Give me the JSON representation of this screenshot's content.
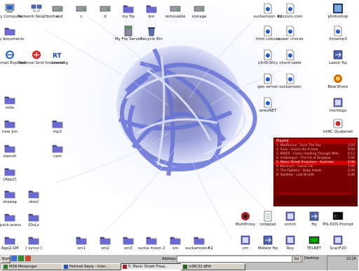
{
  "desktop": {
    "icons_left": [
      {
        "label": "My Computer",
        "icon": "my-computer-icon"
      },
      {
        "label": "Network Neighborhood",
        "icon": "network-icon"
      },
      {
        "label": "e",
        "icon": "drive-icon"
      },
      {
        "label": "c",
        "icon": "drive-icon"
      },
      {
        "label": "d",
        "icon": "drive-icon"
      },
      {
        "label": "my ftp",
        "icon": "folder-icon"
      },
      {
        "label": "bin",
        "icon": "folder-icon"
      },
      {
        "label": "removable",
        "icon": "drive-icon"
      },
      {
        "label": "storage",
        "icon": "drive-icon"
      },
      {
        "label": "my documents",
        "icon": "folder-icon"
      },
      {
        "label": "My Ftp Server",
        "icon": "server-icon"
      },
      {
        "label": "Recycle Bin",
        "icon": "recycle-bin-icon"
      },
      {
        "label": "Internet Explorer",
        "icon": "internet-explorer-icon"
      },
      {
        "label": "National Grid for Learning",
        "icon": "ngfl-icon"
      },
      {
        "label": "connect",
        "icon": "connect-icon"
      },
      {
        "label": "m0e",
        "icon": "folder-icon"
      },
      {
        "label": "new $m",
        "icon": "folder-icon"
      },
      {
        "label": "mp3",
        "icon": "folder-icon"
      },
      {
        "label": "stenoh",
        "icon": "folder-icon"
      },
      {
        "label": "cam",
        "icon": "folder-icon"
      },
      {
        "label": "[App2]",
        "icon": "folder-icon"
      },
      {
        "label": "sheeep",
        "icon": "folder-icon"
      },
      {
        "label": "skool",
        "icon": "folder-icon"
      },
      {
        "label": "quick-acess",
        "icon": "folder-icon"
      },
      {
        "label": "lOoLz",
        "icon": "folder-icon"
      },
      {
        "label": "AppZ.SM",
        "icon": "folder-icon"
      },
      {
        "label": "[ syncz ]",
        "icon": "folder-icon"
      },
      {
        "label": "sm1",
        "icon": "folder-icon"
      },
      {
        "label": "sm2",
        "icon": "folder-icon"
      },
      {
        "label": "sm3",
        "icon": "folder-icon"
      },
      {
        "label": "sucka moon 2",
        "icon": "folder-icon"
      },
      {
        "label": "sm",
        "icon": "folder-icon"
      },
      {
        "label": "suckamoon#2",
        "icon": "folder-icon"
      }
    ],
    "icons_right": [
      {
        "label": "suckamoon #2",
        "icon": "html-file-icon"
      },
      {
        "label": "burzum.com",
        "icon": "html-file-icon"
      },
      {
        "label": "photoshop",
        "icon": "photoshop-icon"
      },
      {
        "label": "html colours",
        "icon": "html-file-icon"
      },
      {
        "label": "power chords",
        "icon": "html-file-icon"
      },
      {
        "label": "ihinamp3",
        "icon": "html-file-icon"
      },
      {
        "label": "z3r0h30ry",
        "icon": "html-file-icon"
      },
      {
        "label": "chord table",
        "icon": "html-file-icon"
      },
      {
        "label": "Leech ftp",
        "icon": "ftp-icon"
      },
      {
        "label": "geo server",
        "icon": "html-file-icon"
      },
      {
        "label": "suckamoon",
        "icon": "html-file-icon"
      },
      {
        "label": "BearShare",
        "icon": "bearshare-icon"
      },
      {
        "label": "wreyNET",
        "icon": "html-file-icon"
      },
      {
        "label": "morhogo",
        "icon": "program-icon"
      },
      {
        "label": "mIRC Quakenet",
        "icon": "mirc-icon"
      },
      {
        "label": "MultiProxy",
        "icon": "multiproxy-icon"
      },
      {
        "label": "notepad",
        "icon": "notepad-icon"
      },
      {
        "label": "snitch",
        "icon": "program-icon"
      },
      {
        "label": "ftp",
        "icon": "ftp-icon"
      },
      {
        "label": "MS-DOS Prompt",
        "icon": "msdos-icon"
      },
      {
        "label": "cm",
        "icon": "program-icon"
      },
      {
        "label": "Meteor ftp",
        "icon": "ftp-icon"
      },
      {
        "label": "Roy",
        "icon": "program-icon"
      },
      {
        "label": "TELNET",
        "icon": "telnet-icon"
      },
      {
        "label": "ScanF20",
        "icon": "program-icon"
      }
    ]
  },
  "player": {
    "title": "Playlist",
    "tracks": [
      {
        "label": "1. MadSunny - Suck The Sky",
        "time": "3:20"
      },
      {
        "label": "2. Sxxx - Head Like A Hole",
        "time": "5:00"
      },
      {
        "label": "3. NWER - Come Heading Through With",
        "time": "4:12"
      },
      {
        "label": "4. Arabesque - The Fat of Singapur",
        "time": "3:56"
      },
      {
        "label": "5. Manic Street Preachers - Australia",
        "time": "4:04"
      },
      {
        "label": "6. Bimmers - Leave Fall",
        "time": "3:41"
      },
      {
        "label": "7. The Fighters - Baby Intent",
        "time": "3:39"
      },
      {
        "label": "8. Swallow - Last Breath",
        "time": "2:48"
      }
    ],
    "selected_index": 4
  },
  "taskbar": {
    "start_label": "Start",
    "address_label": "Address",
    "address_value": "",
    "go_label": "Go",
    "desktop_label": "Desktop",
    "clock": "23:24",
    "tasks": [
      {
        "label": "MSN Messenger",
        "color": "#2a7a2a"
      },
      {
        "label": "Hotmail Reply - Inter...",
        "color": "#2255bb"
      },
      {
        "label": "5. Manic Street Preac...",
        "color": "#aa2222"
      },
      {
        "label": "mIRC32 dEth",
        "color": "#226622"
      }
    ]
  }
}
